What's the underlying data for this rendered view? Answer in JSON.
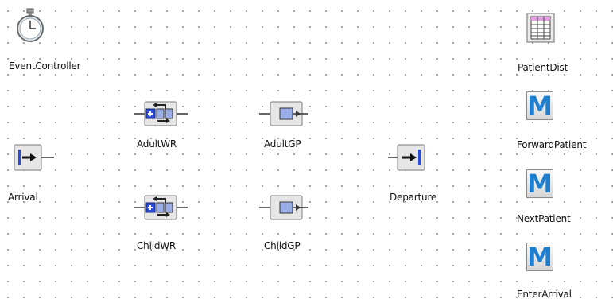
{
  "nodes": {
    "event_controller": "EventController",
    "patient_dist": "PatientDist",
    "adult_wr": "AdultWR",
    "adult_gp": "AdultGP",
    "forward_patient": "ForwardPatient",
    "arrival": "Arrival",
    "departure": "Departure",
    "child_wr": "ChildWR",
    "child_gp": "ChildGP",
    "next_patient": "NextPatient",
    "enter_arrival": "EnterArrival"
  },
  "icons": {
    "event_controller": "stopwatch-icon",
    "patient_dist": "table-icon",
    "queue_server": "queue-server-icon",
    "server": "server-icon",
    "arrival": "arrival-icon",
    "departure": "departure-icon",
    "method": "method-m-icon"
  },
  "colors": {
    "method_letter": "#1e7fd0",
    "queue_blue": "#2b4bd8",
    "server_block": "#9aaee8",
    "grid_dot": "#8a8a8a"
  },
  "method_letter": "M"
}
